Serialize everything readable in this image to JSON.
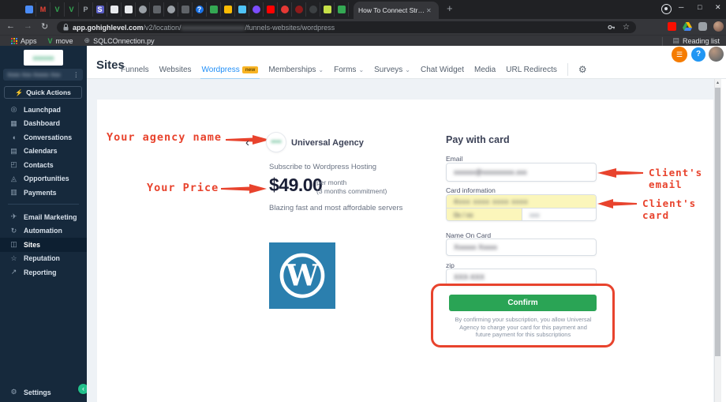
{
  "browser": {
    "active_tab": {
      "title": "How To Connect Stripe To Your A",
      "close_glyph": "✕"
    },
    "new_tab_glyph": "+",
    "window": {
      "minimize": "─",
      "maximize": "□",
      "close": "✕"
    },
    "toolbar": {
      "back": "←",
      "forward": "→",
      "refresh": "↻",
      "kebab": "⋮",
      "star": "☆"
    },
    "url": {
      "domain": "app.gohighlevel.com",
      "path_prefix": "/v2/location/",
      "path_redacted": "xxxxxxxxxxxxxxxxxx",
      "path_suffix": "/funnels-websites/wordpress"
    },
    "bookmarks": {
      "apps": "Apps",
      "move": "move",
      "move_icon": "V",
      "script": "SQLCOnnection.py",
      "globe_icon": "⊕",
      "reading_list": "Reading list",
      "reading_list_icon": "▤"
    },
    "pinned_tabs": [
      {
        "color": "#4a8cf7"
      },
      {
        "glyph": "M",
        "color": "#ea4335"
      },
      {
        "glyph": "V",
        "color": "#34a853"
      },
      {
        "glyph": "V",
        "color": "#34a853"
      },
      {
        "glyph": "P",
        "color": "#9aa0a6"
      },
      {
        "glyph": "S",
        "color": "#ffffff",
        "bg": "#5b5fc7"
      },
      {
        "color": "#e8eaed"
      },
      {
        "color": "#e8eaed"
      },
      {
        "color": "#9aa0a6",
        "round": true
      },
      {
        "color": "#5f6368"
      },
      {
        "color": "#9aa0a6",
        "round": true
      },
      {
        "color": "#5f6368"
      },
      {
        "glyph": "?",
        "color": "#ffffff",
        "bg": "#1a73e8",
        "round": true
      },
      {
        "color": "#34a853"
      },
      {
        "color": "#fbbc04"
      },
      {
        "color": "#4fc3f7"
      },
      {
        "color": "#7c4dff",
        "round": true
      },
      {
        "color": "#ff0000"
      },
      {
        "color": "#e53935",
        "round": true
      },
      {
        "color": "#8e1b1b",
        "round": true
      },
      {
        "color": "#3c4043",
        "round": true
      },
      {
        "color": "#c6e048"
      },
      {
        "color": "#34a853"
      }
    ]
  },
  "sidebar": {
    "logo_text": "xxxxxx",
    "account_selector": "Xxxx Xxx Xxxxx Xxx",
    "selector_menu_glyph": "⋮",
    "quick_actions": {
      "icon": "⚡",
      "label": "Quick Actions"
    },
    "items": [
      {
        "icon": "◎",
        "label": "Launchpad"
      },
      {
        "icon": "▦",
        "label": "Dashboard"
      },
      {
        "icon": "◖",
        "label": "Conversations"
      },
      {
        "icon": "▤",
        "label": "Calendars"
      },
      {
        "icon": "◰",
        "label": "Contacts"
      },
      {
        "icon": "◬",
        "label": "Opportunities"
      },
      {
        "icon": "▥",
        "label": "Payments"
      }
    ],
    "items2": [
      {
        "icon": "✈",
        "label": "Email Marketing"
      },
      {
        "icon": "↻",
        "label": "Automation"
      },
      {
        "icon": "◫",
        "label": "Sites"
      },
      {
        "icon": "☆",
        "label": "Reputation"
      },
      {
        "icon": "↗",
        "label": "Reporting"
      }
    ],
    "settings": {
      "icon": "⚙",
      "label": "Settings"
    },
    "collapse_glyph": "‹"
  },
  "nav": {
    "title": "Sites",
    "tabs": [
      {
        "label": "Funnels"
      },
      {
        "label": "Websites"
      },
      {
        "label": "Wordpress",
        "badge": "new"
      },
      {
        "label": "Memberships"
      },
      {
        "label": "Forms"
      },
      {
        "label": "Surveys"
      },
      {
        "label": "Chat Widget"
      },
      {
        "label": "Media"
      },
      {
        "label": "URL Redirects"
      }
    ],
    "caret_glyph": "⌄",
    "gear_glyph": "⚙",
    "changelog_glyph": "☰",
    "help_glyph": "?"
  },
  "checkout": {
    "back_glyph": "‹",
    "logo_text": "xxxx",
    "merchant": "Universal Agency",
    "subtitle": "Subscribe to Wordpress Hosting",
    "price": "$49.00",
    "price_period": "per month",
    "price_commitment": "(3 months commitment)",
    "tagline": "Blazing fast and most affordable servers"
  },
  "payment": {
    "title": "Pay with card",
    "email_label": "Email",
    "email_value": "xxxxxx@xxxxxxxxx.xxx",
    "card_label": "Card information",
    "card_number_value": "4xxx xxxx xxxx xxxx",
    "card_expiry_value": "0x / xx",
    "card_cvc_value": "xxx",
    "name_label": "Name On Card",
    "name_value": "Xxxxxx Xxxxx",
    "zip_label": "zip",
    "zip_value": "XXX-XXX",
    "confirm_label": "Confirm",
    "disclaimer": "By confirming your subscription, you allow Universal Agency to charge your card for this payment and future payment for this subscriptions"
  },
  "annotations": {
    "agency": "Your agency name",
    "price": "Your Price",
    "email": "Client's email",
    "card": "Client's card"
  },
  "colors": {
    "annotation_red": "#e8432d",
    "confirm_green": "#2aa455",
    "wordpress_blue": "#2b7fae",
    "autofill_yellow": "#fbf6bb",
    "active_tab_blue": "#1f8ef7",
    "new_badge_yellow": "#f8b425"
  }
}
